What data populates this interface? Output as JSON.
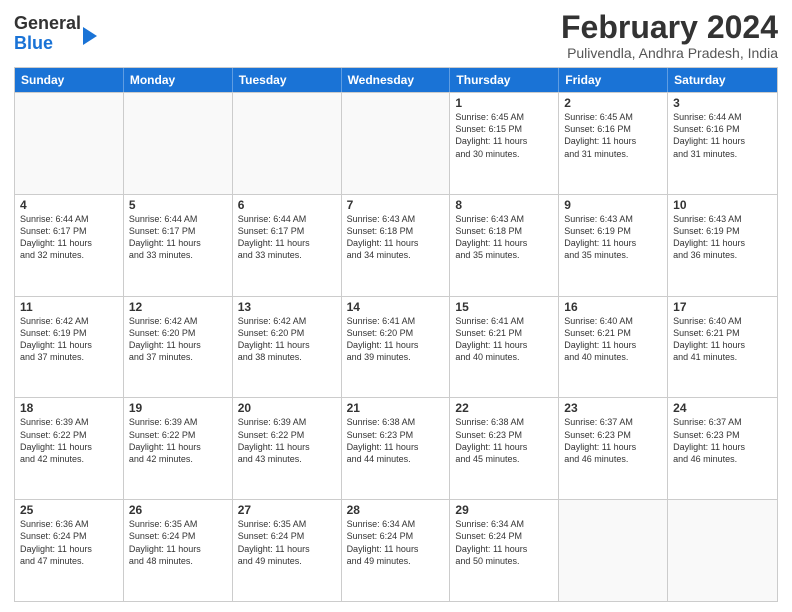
{
  "header": {
    "logo_general": "General",
    "logo_blue": "Blue",
    "title": "February 2024",
    "subtitle": "Pulivendla, Andhra Pradesh, India"
  },
  "calendar": {
    "days_of_week": [
      "Sunday",
      "Monday",
      "Tuesday",
      "Wednesday",
      "Thursday",
      "Friday",
      "Saturday"
    ],
    "rows": [
      [
        {
          "day": "",
          "info": "",
          "empty": true
        },
        {
          "day": "",
          "info": "",
          "empty": true
        },
        {
          "day": "",
          "info": "",
          "empty": true
        },
        {
          "day": "",
          "info": "",
          "empty": true
        },
        {
          "day": "1",
          "info": "Sunrise: 6:45 AM\nSunset: 6:15 PM\nDaylight: 11 hours\nand 30 minutes."
        },
        {
          "day": "2",
          "info": "Sunrise: 6:45 AM\nSunset: 6:16 PM\nDaylight: 11 hours\nand 31 minutes."
        },
        {
          "day": "3",
          "info": "Sunrise: 6:44 AM\nSunset: 6:16 PM\nDaylight: 11 hours\nand 31 minutes."
        }
      ],
      [
        {
          "day": "4",
          "info": "Sunrise: 6:44 AM\nSunset: 6:17 PM\nDaylight: 11 hours\nand 32 minutes."
        },
        {
          "day": "5",
          "info": "Sunrise: 6:44 AM\nSunset: 6:17 PM\nDaylight: 11 hours\nand 33 minutes."
        },
        {
          "day": "6",
          "info": "Sunrise: 6:44 AM\nSunset: 6:17 PM\nDaylight: 11 hours\nand 33 minutes."
        },
        {
          "day": "7",
          "info": "Sunrise: 6:43 AM\nSunset: 6:18 PM\nDaylight: 11 hours\nand 34 minutes."
        },
        {
          "day": "8",
          "info": "Sunrise: 6:43 AM\nSunset: 6:18 PM\nDaylight: 11 hours\nand 35 minutes."
        },
        {
          "day": "9",
          "info": "Sunrise: 6:43 AM\nSunset: 6:19 PM\nDaylight: 11 hours\nand 35 minutes."
        },
        {
          "day": "10",
          "info": "Sunrise: 6:43 AM\nSunset: 6:19 PM\nDaylight: 11 hours\nand 36 minutes."
        }
      ],
      [
        {
          "day": "11",
          "info": "Sunrise: 6:42 AM\nSunset: 6:19 PM\nDaylight: 11 hours\nand 37 minutes."
        },
        {
          "day": "12",
          "info": "Sunrise: 6:42 AM\nSunset: 6:20 PM\nDaylight: 11 hours\nand 37 minutes."
        },
        {
          "day": "13",
          "info": "Sunrise: 6:42 AM\nSunset: 6:20 PM\nDaylight: 11 hours\nand 38 minutes."
        },
        {
          "day": "14",
          "info": "Sunrise: 6:41 AM\nSunset: 6:20 PM\nDaylight: 11 hours\nand 39 minutes."
        },
        {
          "day": "15",
          "info": "Sunrise: 6:41 AM\nSunset: 6:21 PM\nDaylight: 11 hours\nand 40 minutes."
        },
        {
          "day": "16",
          "info": "Sunrise: 6:40 AM\nSunset: 6:21 PM\nDaylight: 11 hours\nand 40 minutes."
        },
        {
          "day": "17",
          "info": "Sunrise: 6:40 AM\nSunset: 6:21 PM\nDaylight: 11 hours\nand 41 minutes."
        }
      ],
      [
        {
          "day": "18",
          "info": "Sunrise: 6:39 AM\nSunset: 6:22 PM\nDaylight: 11 hours\nand 42 minutes."
        },
        {
          "day": "19",
          "info": "Sunrise: 6:39 AM\nSunset: 6:22 PM\nDaylight: 11 hours\nand 42 minutes."
        },
        {
          "day": "20",
          "info": "Sunrise: 6:39 AM\nSunset: 6:22 PM\nDaylight: 11 hours\nand 43 minutes."
        },
        {
          "day": "21",
          "info": "Sunrise: 6:38 AM\nSunset: 6:23 PM\nDaylight: 11 hours\nand 44 minutes."
        },
        {
          "day": "22",
          "info": "Sunrise: 6:38 AM\nSunset: 6:23 PM\nDaylight: 11 hours\nand 45 minutes."
        },
        {
          "day": "23",
          "info": "Sunrise: 6:37 AM\nSunset: 6:23 PM\nDaylight: 11 hours\nand 46 minutes."
        },
        {
          "day": "24",
          "info": "Sunrise: 6:37 AM\nSunset: 6:23 PM\nDaylight: 11 hours\nand 46 minutes."
        }
      ],
      [
        {
          "day": "25",
          "info": "Sunrise: 6:36 AM\nSunset: 6:24 PM\nDaylight: 11 hours\nand 47 minutes."
        },
        {
          "day": "26",
          "info": "Sunrise: 6:35 AM\nSunset: 6:24 PM\nDaylight: 11 hours\nand 48 minutes."
        },
        {
          "day": "27",
          "info": "Sunrise: 6:35 AM\nSunset: 6:24 PM\nDaylight: 11 hours\nand 49 minutes."
        },
        {
          "day": "28",
          "info": "Sunrise: 6:34 AM\nSunset: 6:24 PM\nDaylight: 11 hours\nand 49 minutes."
        },
        {
          "day": "29",
          "info": "Sunrise: 6:34 AM\nSunset: 6:24 PM\nDaylight: 11 hours\nand 50 minutes."
        },
        {
          "day": "",
          "info": "",
          "empty": true
        },
        {
          "day": "",
          "info": "",
          "empty": true
        }
      ]
    ]
  }
}
